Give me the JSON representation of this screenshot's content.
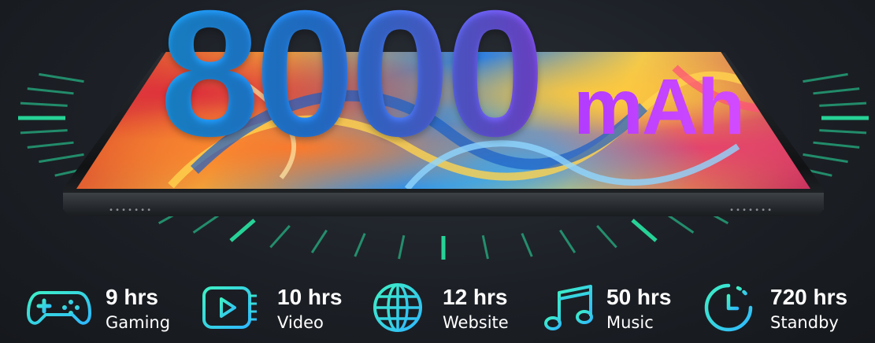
{
  "headline": {
    "capacity": "8000",
    "unit": "mAh"
  },
  "colors": {
    "accent_green": "#29e6a4",
    "icon_gradient_start": "#3ef0c4",
    "icon_gradient_end": "#2fb8ff",
    "title_blue": "#1ea7ff",
    "title_purple": "#b23bff"
  },
  "features": [
    {
      "hours": "9 hrs",
      "label": "Gaming",
      "icon": "gamepad-icon"
    },
    {
      "hours": "10 hrs",
      "label": "Video",
      "icon": "video-play-icon"
    },
    {
      "hours": "12 hrs",
      "label": "Website",
      "icon": "globe-icon"
    },
    {
      "hours": "50 hrs",
      "label": "Music",
      "icon": "music-note-icon"
    },
    {
      "hours": "720 hrs",
      "label": "Standby",
      "icon": "clock-icon"
    }
  ]
}
